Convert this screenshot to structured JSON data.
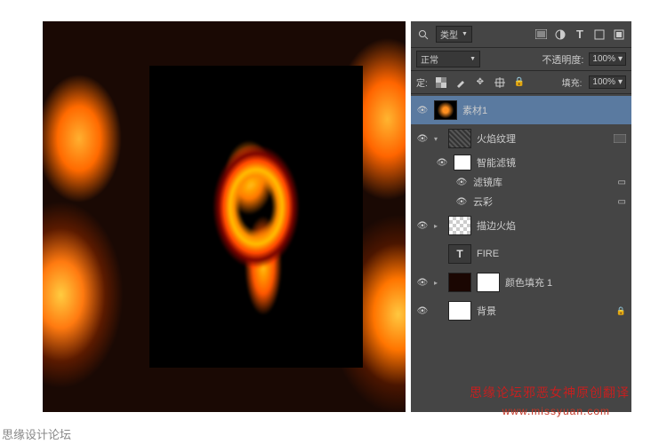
{
  "topRow": {
    "filter": "类型"
  },
  "blend": {
    "mode": "正常",
    "opacityLabel": "不透明度:",
    "opacity": "100%"
  },
  "lock": {
    "label": "定:",
    "fillLabel": "填充:",
    "fill": "100%"
  },
  "layers": {
    "l1": "素材1",
    "l2": "火焰纹理",
    "l2a": "智能滤镜",
    "l2b": "滤镜库",
    "l2c": "云彩",
    "l3": "描边火焰",
    "l4": "FIRE",
    "l5": "颜色填充 1",
    "l6": "背景"
  },
  "watermark": {
    "line1": "思缘论坛邪恶女神原创翻译",
    "line2": "www.missyuan.com"
  },
  "footer": "思缘设计论坛"
}
